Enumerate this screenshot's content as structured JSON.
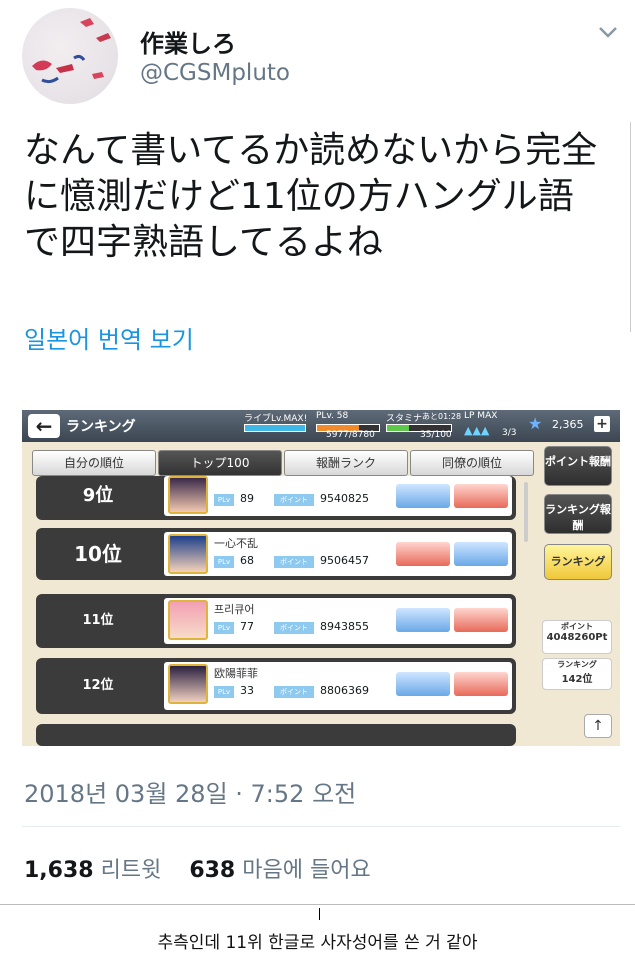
{
  "tweet": {
    "display_name": "作業しろ",
    "handle": "@CGSMpluto",
    "text_lines": [
      "なんて書いてるか読めないから完全",
      "に憶測だけど11位の方ハングル語",
      "で四字熟語してるよね"
    ],
    "translate_label": "일본어 번역 보기",
    "timestamp": "2018년 03월 28일 · 7:52 오전",
    "retweets_count": "1,638",
    "retweets_label": "리트윗",
    "likes_count": "638",
    "likes_label": "마음에 들어요"
  },
  "game": {
    "title": "ランキング",
    "live_label": "ライブLv.MAX!",
    "plv_label": "PLv. 58",
    "plv_value": "5977/8780",
    "stamina_label": "スタミナ",
    "stamina_time": "あと01:28",
    "stamina_value": "35/100",
    "lp_label": "LP MAX",
    "lp_value": "3/3",
    "coins": "2,365",
    "tabs": [
      "自分の順位",
      "トップ100",
      "報酬ランク",
      "同僚の順位"
    ],
    "rows": [
      {
        "rank": "9位",
        "name": "",
        "plv": "89",
        "points": "9540825"
      },
      {
        "rank": "10位",
        "name": "一心不乱",
        "plv": "68",
        "points": "9506457"
      },
      {
        "rank": "11位",
        "name": "프리큐어",
        "plv": "77",
        "points": "8943855"
      },
      {
        "rank": "12位",
        "name": "欧陽菲菲",
        "plv": "33",
        "points": "8806369"
      }
    ],
    "plv_tag": "PLv",
    "points_tag": "ポイント",
    "side": {
      "point_reward": "ポイント報酬",
      "ranking_reward": "ランキング報酬",
      "ranking": "ランキング",
      "my_points_label": "ポイント",
      "my_points": "4048260Pt",
      "my_rank_label": "ランキング",
      "my_rank": "142位"
    }
  },
  "caption": "추측인데 11위 한글로 사자성어를 쓴 거 같아",
  "colors": {
    "link": "#1b95e0",
    "muted": "#657786"
  }
}
